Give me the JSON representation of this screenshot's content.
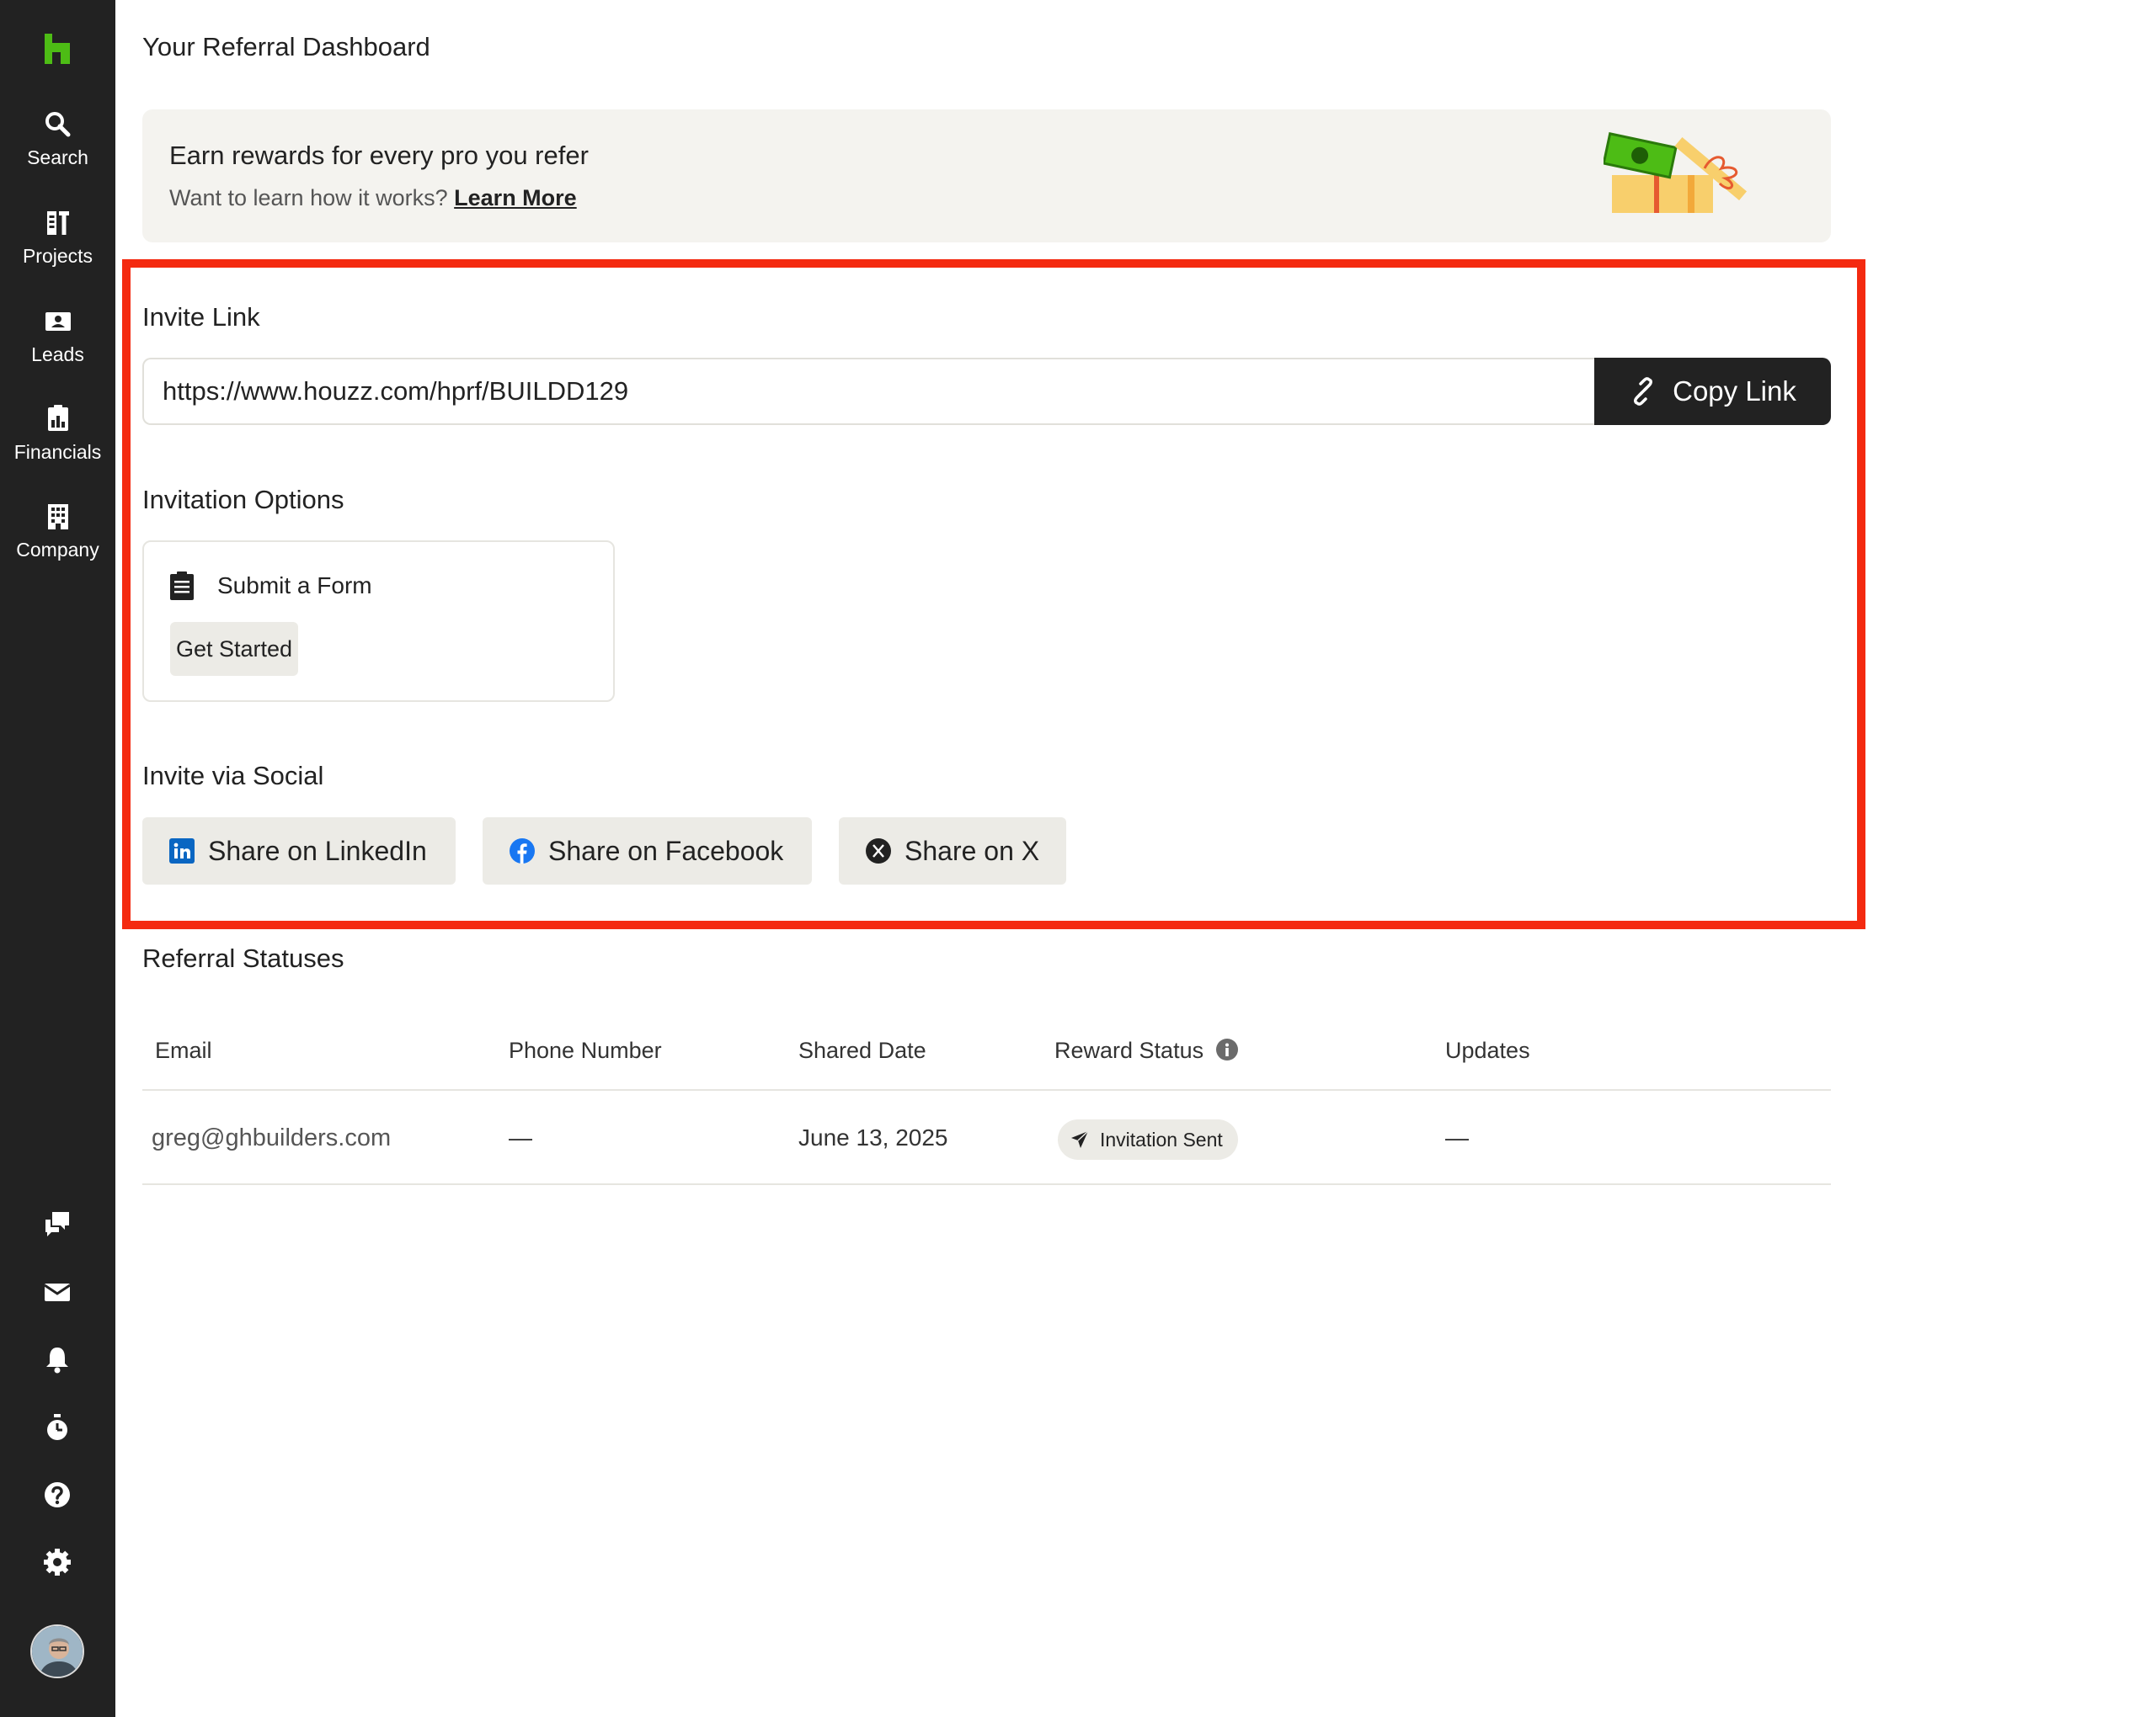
{
  "sidebar": {
    "logo_icon": "houzz-logo-icon",
    "nav": [
      {
        "label": "Search",
        "icon": "search-icon"
      },
      {
        "label": "Projects",
        "icon": "projects-icon"
      },
      {
        "label": "Leads",
        "icon": "leads-icon"
      },
      {
        "label": "Financials",
        "icon": "financials-icon"
      },
      {
        "label": "Company",
        "icon": "company-icon"
      }
    ],
    "bottom_icons": [
      "chat-icon",
      "mail-icon",
      "bell-icon",
      "timer-icon",
      "help-icon",
      "gear-icon"
    ],
    "avatar": "user-avatar"
  },
  "page": {
    "title": "Your Referral Dashboard"
  },
  "banner": {
    "title": "Earn rewards for every pro you refer",
    "subtitle": "Want to learn how it works?",
    "learn_more": "Learn More"
  },
  "invite_link": {
    "title": "Invite Link",
    "url": "https://www.houzz.com/hprf/BUILDD129",
    "copy_label": "Copy Link"
  },
  "invitation_options": {
    "title": "Invitation Options",
    "option_label": "Submit a Form",
    "button_label": "Get Started"
  },
  "social": {
    "title": "Invite via Social",
    "linkedin": "Share on LinkedIn",
    "facebook": "Share on Facebook",
    "x": "Share on X"
  },
  "referrals": {
    "title": "Referral Statuses",
    "columns": [
      "Email",
      "Phone Number",
      "Shared Date",
      "Reward Status",
      "Updates"
    ],
    "rows": [
      {
        "email": "greg@ghbuilders.com",
        "phone": "—",
        "shared_date": "June 13, 2025",
        "status": "Invitation Sent",
        "updates": "—"
      }
    ]
  },
  "colors": {
    "sidebar_bg": "#222222",
    "brand_green": "#4dbc15",
    "highlight_border": "#f42a10",
    "banner_bg": "#f4f3ef",
    "button_dark": "#222222",
    "button_light": "#ecebe6",
    "linkedin_blue": "#0a66c2",
    "facebook_blue": "#1877f2"
  }
}
